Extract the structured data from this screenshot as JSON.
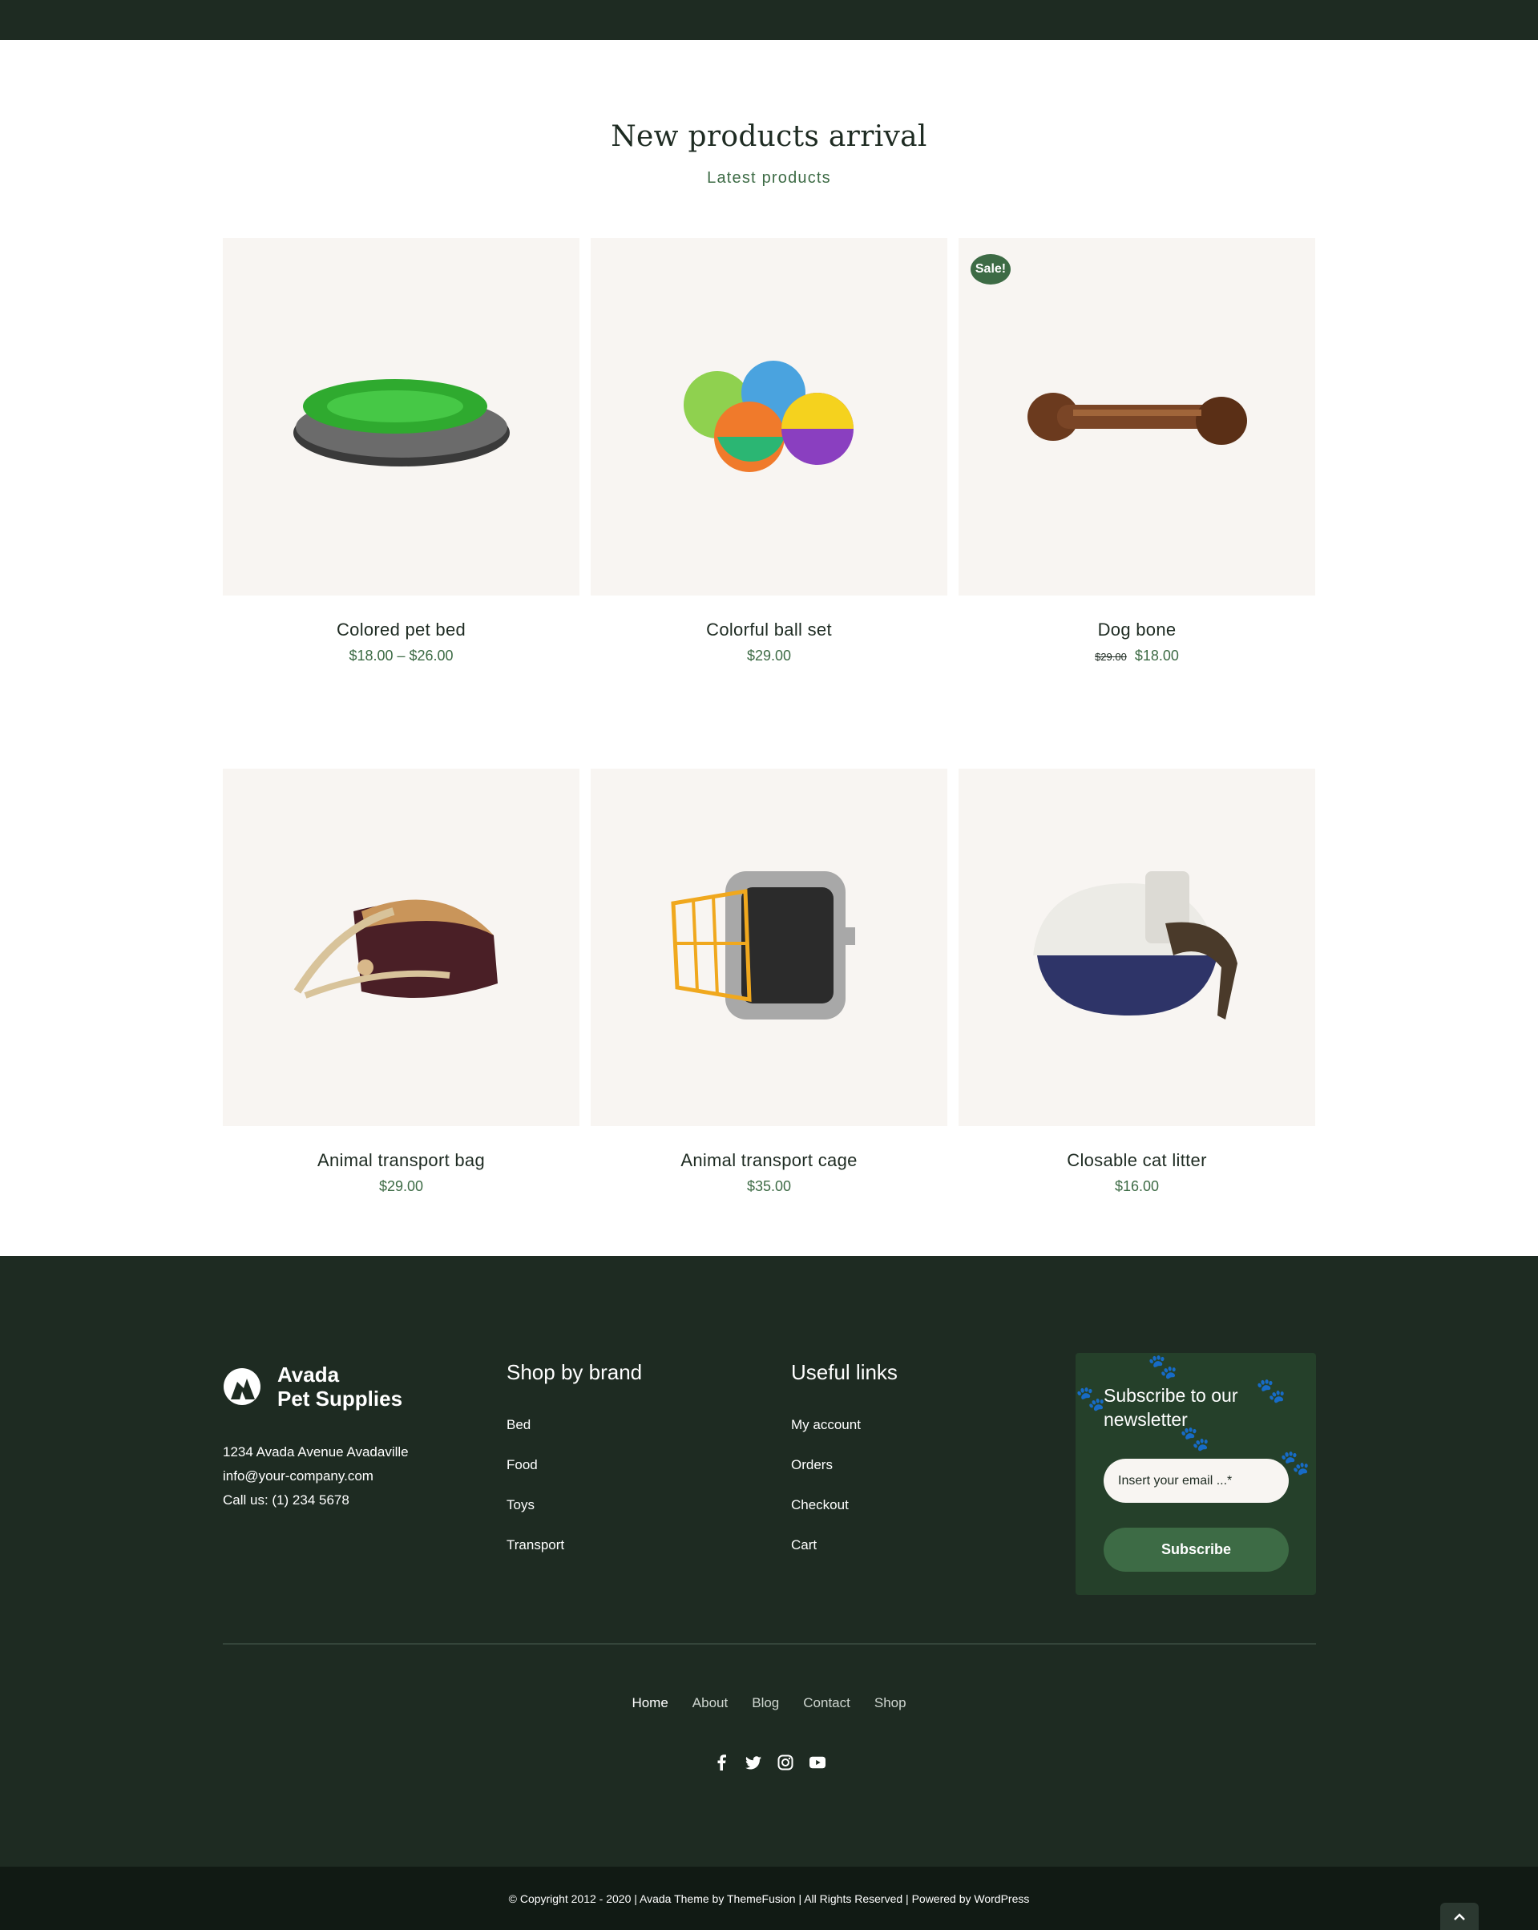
{
  "section": {
    "title": "New products arrival",
    "subtitle": "Latest products"
  },
  "products": [
    {
      "name": "Colored pet bed",
      "price": "$18.00 – $26.00",
      "image_icon": "pet-bed-image"
    },
    {
      "name": "Colorful ball set",
      "price": "$29.00",
      "image_icon": "ball-set-image"
    },
    {
      "name": "Dog bone",
      "old_price": "$29.00",
      "price": "$18.00",
      "badge": "Sale!",
      "image_icon": "dog-bone-image"
    },
    {
      "name": "Animal transport bag",
      "price": "$29.00",
      "image_icon": "transport-bag-image"
    },
    {
      "name": "Animal transport cage",
      "price": "$35.00",
      "image_icon": "transport-cage-image"
    },
    {
      "name": "Closable cat litter",
      "price": "$16.00",
      "image_icon": "cat-litter-image"
    }
  ],
  "footer": {
    "brand_line1": "Avada",
    "brand_line2": "Pet Supplies",
    "address": "1234 Avada Avenue Avadaville",
    "email": "info@your-company.com",
    "phone": "Call us: (1) 234 5678",
    "shop_by_brand": {
      "title": "Shop by brand",
      "links": [
        "Bed",
        "Food",
        "Toys",
        "Transport"
      ]
    },
    "useful_links": {
      "title": "Useful links",
      "links": [
        "My account",
        "Orders",
        "Checkout",
        "Cart"
      ]
    },
    "newsletter": {
      "title": "Subscribe to our newsletter",
      "placeholder": "Insert your email ...*",
      "button": "Subscribe"
    },
    "nav": [
      "Home",
      "About",
      "Blog",
      "Contact",
      "Shop"
    ],
    "social_icons": [
      "facebook-icon",
      "twitter-icon",
      "instagram-icon",
      "youtube-icon"
    ],
    "copyright": "© Copyright 2012 - 2020 | Avada Theme by ThemeFusion | All Rights Reserved | Powered by WordPress"
  },
  "colors": {
    "dark_green": "#1e2b22",
    "accent_green": "#3d6b45",
    "card_bg": "#f8f5f2"
  }
}
